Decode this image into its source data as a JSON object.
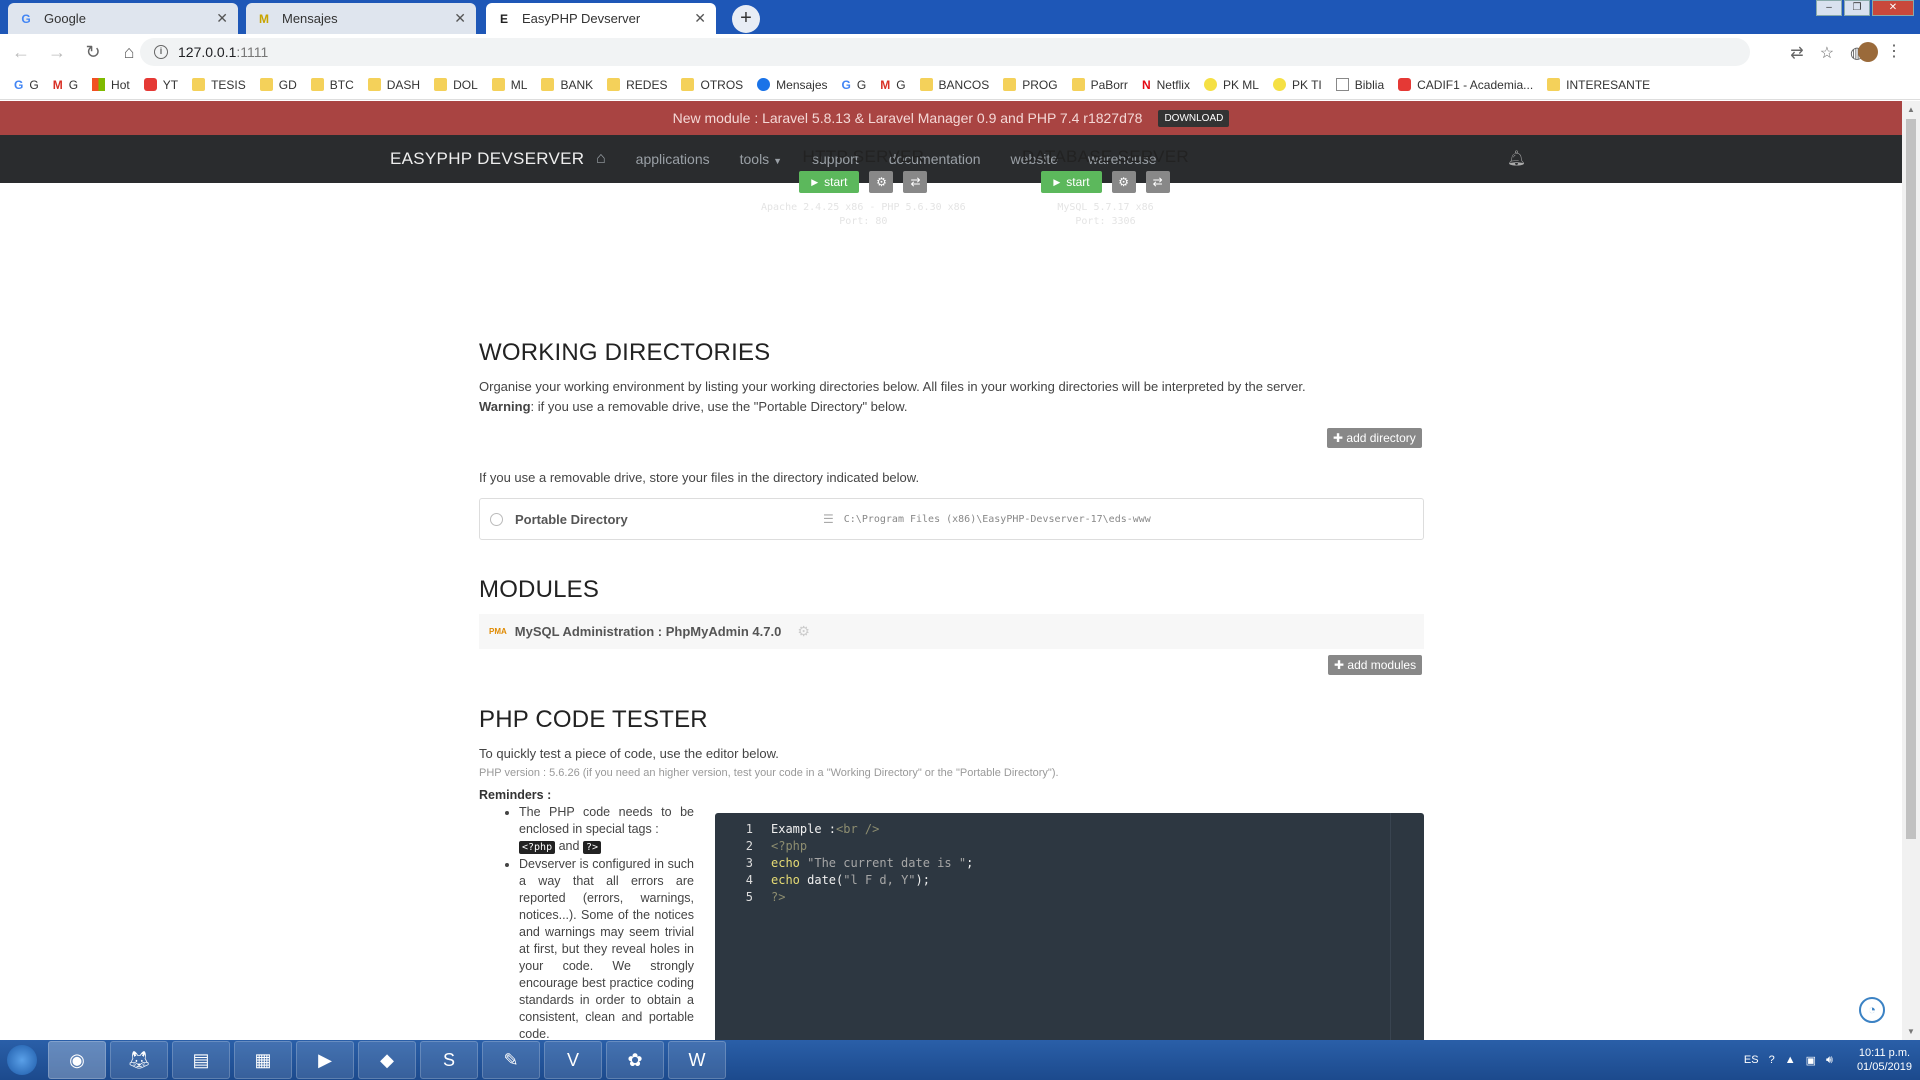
{
  "browser": {
    "tabs": [
      {
        "title": "Google",
        "fav": "G"
      },
      {
        "title": "Mensajes",
        "fav": "M"
      },
      {
        "title": "EasyPHP Devserver",
        "fav": "E"
      }
    ],
    "url_host": "127.0.0.1",
    "url_port": ":1111",
    "bookmarks": [
      {
        "label": "G",
        "icon": "g"
      },
      {
        "label": "G",
        "icon": "m"
      },
      {
        "label": "Hot",
        "icon": "ms"
      },
      {
        "label": "YT",
        "icon": "red"
      },
      {
        "label": "TESIS",
        "icon": "folder"
      },
      {
        "label": "GD",
        "icon": "folder"
      },
      {
        "label": "BTC",
        "icon": "folder"
      },
      {
        "label": "DASH",
        "icon": "folder"
      },
      {
        "label": "DOL",
        "icon": "folder"
      },
      {
        "label": "ML",
        "icon": "folder"
      },
      {
        "label": "BANK",
        "icon": "folder"
      },
      {
        "label": "REDES",
        "icon": "folder"
      },
      {
        "label": "OTROS",
        "icon": "folder"
      },
      {
        "label": "Mensajes",
        "icon": "blue"
      },
      {
        "label": "G",
        "icon": "g"
      },
      {
        "label": "G",
        "icon": "m"
      },
      {
        "label": "BANCOS",
        "icon": "folder"
      },
      {
        "label": "PROG",
        "icon": "folder"
      },
      {
        "label": "PaBorr",
        "icon": "folder"
      },
      {
        "label": "Netflix",
        "icon": "n"
      },
      {
        "label": "PK ML",
        "icon": "ml"
      },
      {
        "label": "PK TI",
        "icon": "ml"
      },
      {
        "label": "Biblia",
        "icon": "doc"
      },
      {
        "label": "CADIF1 - Academia...",
        "icon": "red"
      },
      {
        "label": "INTERESANTE",
        "icon": "folder"
      }
    ]
  },
  "announce": {
    "text": "New module : Laravel 5.8.13 & Laravel Manager 0.9 and PHP 7.4 r1827d78",
    "download": "DOWNLOAD"
  },
  "nav": {
    "brand": "EASYPHP DEVSERVER",
    "links": [
      "applications",
      "tools",
      "support",
      "documentation",
      "website",
      "warehouse"
    ]
  },
  "servers": {
    "http": {
      "title": "HTTP SERVER",
      "start": "start",
      "version": "Apache 2.4.25 x86 - PHP 5.6.30 x86",
      "port": "Port: 80"
    },
    "db": {
      "title": "DATABASE SERVER",
      "start": "start",
      "version": "MySQL 5.7.17 x86",
      "port": "Port: 3306"
    }
  },
  "working": {
    "title": "WORKING DIRECTORIES",
    "desc": "Organise your working environment by listing your working directories below. All files in your working directories will be interpreted by the server.",
    "warning_label": "Warning",
    "warning_text": ": if you use a removable drive, use the \"Portable Directory\" below.",
    "add_btn": "add directory",
    "removable": "If you use a removable drive, store your files in the directory indicated below.",
    "portable_name": "Portable Directory",
    "portable_path": "C:\\Program Files (x86)\\EasyPHP-Devserver-17\\eds-www"
  },
  "modules": {
    "title": "MODULES",
    "item": "MySQL Administration : PhpMyAdmin 4.7.0",
    "pma_label": "PMA",
    "add_btn": "add modules"
  },
  "tester": {
    "title": "PHP CODE TESTER",
    "desc": "To quickly test a piece of code, use the editor below.",
    "version_note": "PHP version : 5.6.26 (if you need an higher version, test your code in a \"Working Directory\" or the \"Portable Directory\").",
    "reminders_head": "Reminders :",
    "reminder1_a": "The PHP code needs to be enclosed in special tags :",
    "tag_open": "<?php",
    "and": "and",
    "tag_close": "?>",
    "reminder2": "Devserver is configured in such a way that all errors are reported (errors, warnings, notices...). Some of the notices and warnings may seem trivial at first, but they reveal holes in your code. We strongly encourage best practice coding standards in order to obtain a consistent, clean and portable code.",
    "code_lines": [
      {
        "n": "1",
        "parts": [
          {
            "t": "Example :",
            "c": "k-plain"
          },
          {
            "t": "<br />",
            "c": "k-tag"
          }
        ]
      },
      {
        "n": "2",
        "parts": [
          {
            "t": "<?php",
            "c": "k-tag"
          }
        ]
      },
      {
        "n": "3",
        "parts": [
          {
            "t": "echo ",
            "c": "k-kw"
          },
          {
            "t": "\"The current date is \"",
            "c": "k-str"
          },
          {
            "t": ";",
            "c": "k-plain"
          }
        ]
      },
      {
        "n": "4",
        "parts": [
          {
            "t": "echo ",
            "c": "k-kw"
          },
          {
            "t": "date",
            "c": "k-plain"
          },
          {
            "t": "(",
            "c": "k-plain"
          },
          {
            "t": "\"l F d, Y\"",
            "c": "k-str"
          },
          {
            "t": ");",
            "c": "k-plain"
          }
        ]
      },
      {
        "n": "5",
        "parts": [
          {
            "t": "?>",
            "c": "k-tag"
          }
        ]
      }
    ]
  },
  "taskbar": {
    "lang": "ES",
    "time": "10:11 p.m.",
    "date": "01/05/2019"
  }
}
